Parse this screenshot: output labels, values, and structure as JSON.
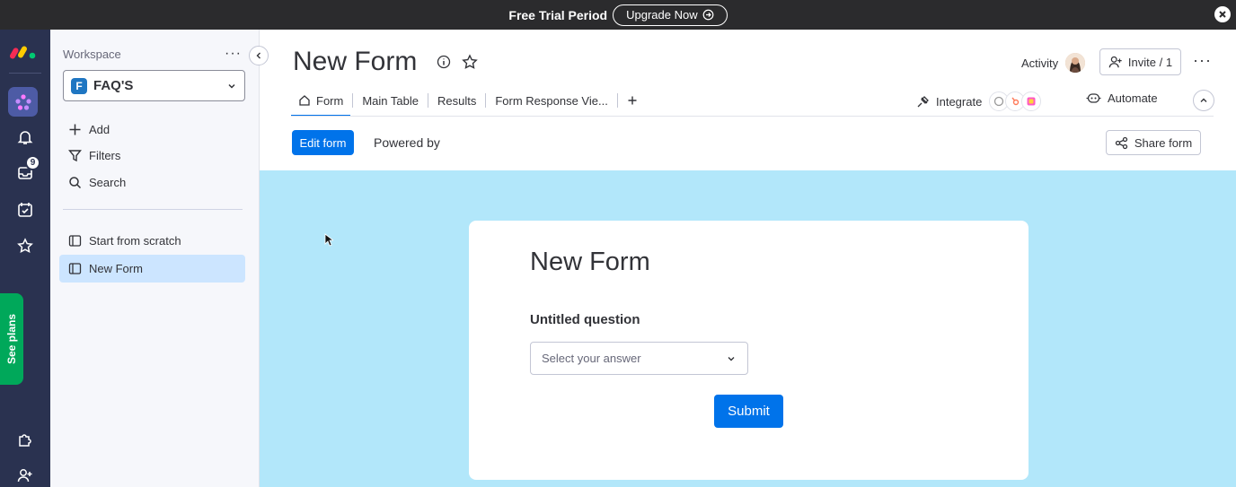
{
  "banner": {
    "text": "Free Trial Period",
    "upgrade_label": "Upgrade Now"
  },
  "rail": {
    "notification_count": "9",
    "see_plans_label": "See plans"
  },
  "sidebar": {
    "workspace_label": "Workspace",
    "workspace_letter": "F",
    "workspace_name": "FAQ'S",
    "actions": [
      {
        "label": "Add",
        "icon": "plus-icon"
      },
      {
        "label": "Filters",
        "icon": "filter-icon"
      },
      {
        "label": "Search",
        "icon": "search-icon"
      }
    ],
    "boards": [
      {
        "label": "Start from scratch",
        "active": false
      },
      {
        "label": "New Form",
        "active": true
      }
    ]
  },
  "header": {
    "title": "New Form",
    "activity_label": "Activity",
    "invite_label": "Invite / 1",
    "tabs": [
      {
        "label": "Form",
        "active": true
      },
      {
        "label": "Main Table"
      },
      {
        "label": "Results"
      },
      {
        "label": "Form Response Vie..."
      }
    ],
    "integrate_label": "Integrate",
    "automate_label": "Automate"
  },
  "toolbar": {
    "edit_label": "Edit form",
    "powered_label": "Powered by",
    "share_label": "Share form"
  },
  "form": {
    "title": "New Form",
    "question_label": "Untitled question",
    "answer_placeholder": "Select your answer",
    "submit_label": "Submit"
  },
  "colors": {
    "primary": "#0073ea",
    "canvas": "#b2e7fa",
    "rail": "#2a3250",
    "see_plans": "#00a85a"
  }
}
